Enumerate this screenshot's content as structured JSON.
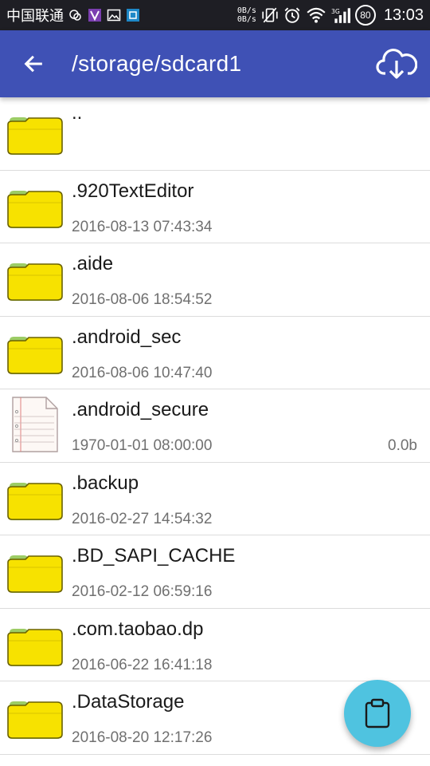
{
  "status_bar": {
    "carrier": "中国联通",
    "net_up": "0B/s",
    "net_down": "0B/s",
    "battery": "80",
    "time": "13:03"
  },
  "app_bar": {
    "title": "/storage/sdcard1"
  },
  "files": [
    {
      "name": "..",
      "date": "",
      "size": "",
      "type": "folder"
    },
    {
      "name": ".920TextEditor",
      "date": "2016-08-13 07:43:34",
      "size": "",
      "type": "folder"
    },
    {
      "name": ".aide",
      "date": "2016-08-06 18:54:52",
      "size": "",
      "type": "folder"
    },
    {
      "name": ".android_sec",
      "date": "2016-08-06 10:47:40",
      "size": "",
      "type": "folder"
    },
    {
      "name": ".android_secure",
      "date": "1970-01-01 08:00:00",
      "size": "0.0b",
      "type": "file"
    },
    {
      "name": ".backup",
      "date": "2016-02-27 14:54:32",
      "size": "",
      "type": "folder"
    },
    {
      "name": ".BD_SAPI_CACHE",
      "date": "2016-02-12 06:59:16",
      "size": "",
      "type": "folder"
    },
    {
      "name": ".com.taobao.dp",
      "date": "2016-06-22 16:41:18",
      "size": "",
      "type": "folder"
    },
    {
      "name": ".DataStorage",
      "date": "2016-08-20 12:17:26",
      "size": "",
      "type": "folder"
    }
  ],
  "colors": {
    "app_bar": "#3f51b5",
    "status_bar": "#1e1e24",
    "fab": "#4fc3e0",
    "folder": "#f7e200"
  },
  "icons": {
    "back": "arrow-left-icon",
    "download": "cloud-download-icon",
    "fab": "clipboard-icon",
    "folder": "folder-icon",
    "file": "document-icon"
  }
}
